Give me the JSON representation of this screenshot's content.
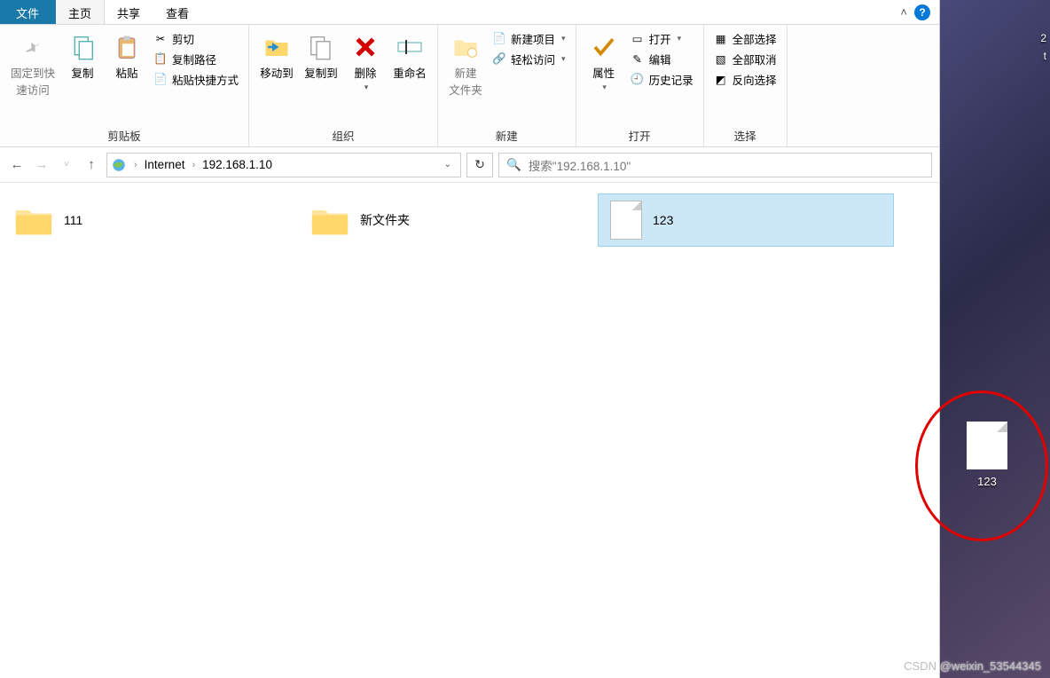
{
  "tabs": {
    "file": "文件",
    "home": "主页",
    "share": "共享",
    "view": "查看"
  },
  "ribbon": {
    "clipboard": {
      "pin": "固定到快\n速访问",
      "copy": "复制",
      "paste": "粘贴",
      "cut": "剪切",
      "copypath": "复制路径",
      "pasteshortcut": "粘贴快捷方式",
      "label": "剪贴板"
    },
    "organize": {
      "moveto": "移动到",
      "copyto": "复制到",
      "delete": "删除",
      "rename": "重命名",
      "label": "组织"
    },
    "new": {
      "newfolder": "新建\n文件夹",
      "newitem": "新建项目",
      "easyaccess": "轻松访问",
      "label": "新建"
    },
    "open": {
      "properties": "属性",
      "open": "打开",
      "edit": "编辑",
      "history": "历史记录",
      "label": "打开"
    },
    "select": {
      "selectall": "全部选择",
      "selectnone": "全部取消",
      "invert": "反向选择",
      "label": "选择"
    }
  },
  "address": {
    "crumb1": "Internet",
    "crumb2": "192.168.1.10"
  },
  "search": {
    "placeholder": "搜索\"192.168.1.10\""
  },
  "items": {
    "f1": "111",
    "f2": "新文件夹",
    "f3": "123"
  },
  "desktop": {
    "item1": "123",
    "letter2": "2",
    "lettert": "t"
  },
  "watermark": "CSDN @weixin_53544345"
}
